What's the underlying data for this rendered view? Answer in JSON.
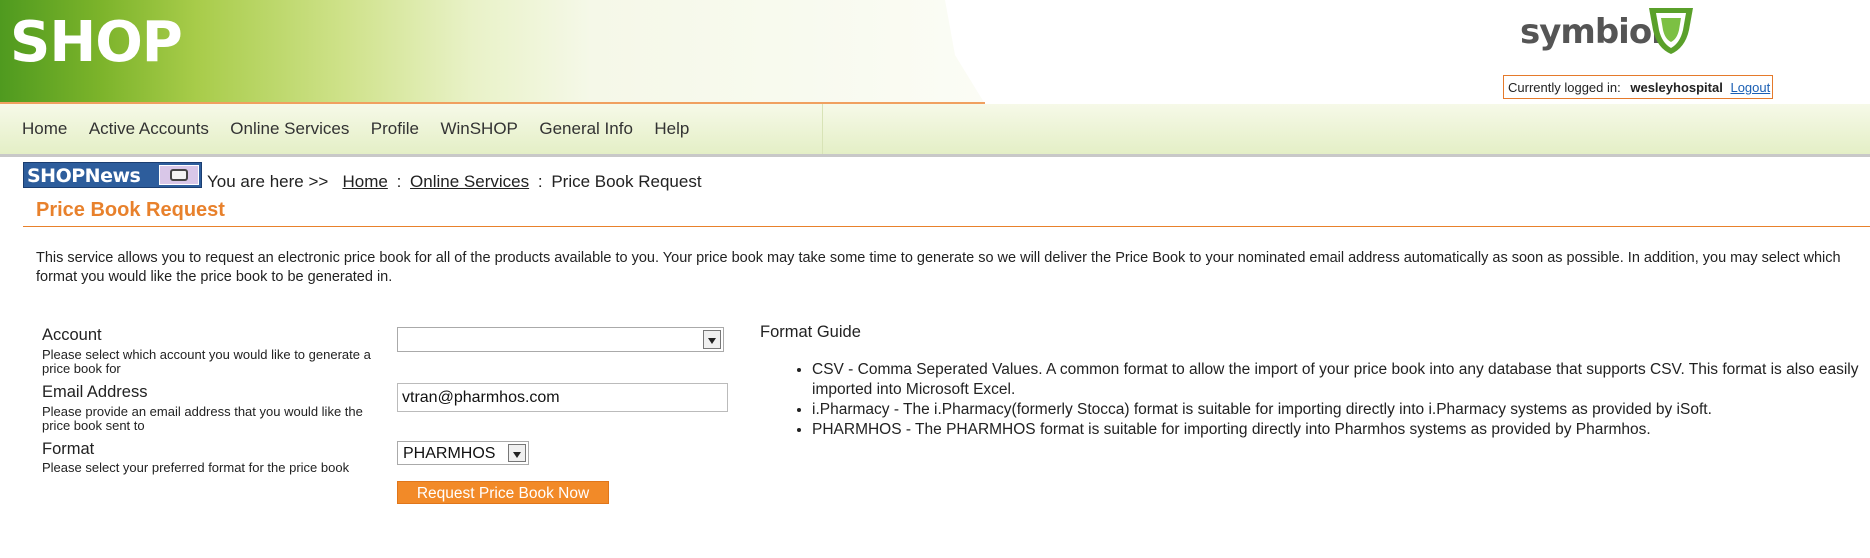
{
  "header": {
    "logo_text": "SHOP",
    "brand_name": "symbion",
    "login_label": "Currently logged in:",
    "username": "wesleyhospital",
    "logout_label": "Logout"
  },
  "nav": {
    "items": [
      "Home",
      "Active Accounts",
      "Online Services",
      "Profile",
      "WinSHOP",
      "General Info",
      "Help"
    ]
  },
  "news_badge": {
    "text": "SHOPNews"
  },
  "breadcrumb": {
    "prefix": "You are here >>",
    "home": "Home",
    "section": "Online Services",
    "current": "Price Book Request",
    "separator": ":"
  },
  "page": {
    "title": "Price Book Request",
    "intro": "This service allows you to request an electronic price book for all of the products available to you. Your price book may take some time to generate so we will deliver the Price Book to your nominated email address automatically as soon as possible. In addition, you may select which format you would like the price book to be generated in."
  },
  "form": {
    "account_label": "Account",
    "account_help": "Please select which account you would like to generate a price book for",
    "account_value": "",
    "email_label": "Email Address",
    "email_help": "Please provide an email address that you would like the price book sent to",
    "email_value": "vtran@pharmhos.com",
    "format_label": "Format",
    "format_help": "Please select your preferred format for the price book",
    "format_value": "PHARMHOS",
    "submit_label": "Request Price Book Now"
  },
  "format_guide": {
    "title": "Format Guide",
    "items": [
      "CSV - Comma Seperated Values. A common format to allow the import of your price book into any database that supports CSV. This format is also easily imported into Microsoft Excel.",
      "i.Pharmacy - The i.Pharmacy(formerly Stocca) format is suitable for importing directly into i.Pharmacy systems as provided by iSoft.",
      "PHARMHOS - The PHARMHOS format is suitable for importing directly into Pharmhos systems as provided by Pharmhos."
    ]
  },
  "colors": {
    "accent": "#e8812c",
    "header_green": "#4f9a1f",
    "button": "#f28a28",
    "link": "#1a5fb4"
  }
}
